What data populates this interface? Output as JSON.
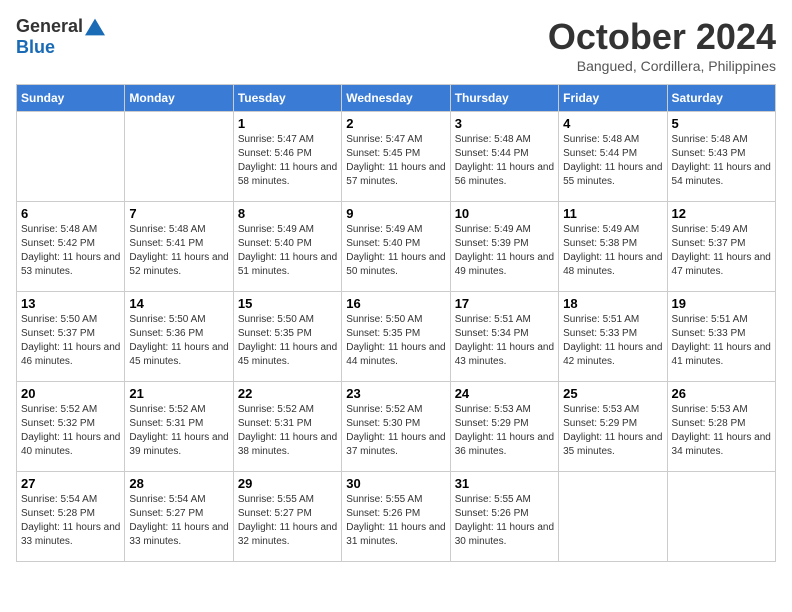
{
  "header": {
    "logo_general": "General",
    "logo_blue": "Blue",
    "month_title": "October 2024",
    "subtitle": "Bangued, Cordillera, Philippines"
  },
  "weekdays": [
    "Sunday",
    "Monday",
    "Tuesday",
    "Wednesday",
    "Thursday",
    "Friday",
    "Saturday"
  ],
  "weeks": [
    [
      {
        "day": "",
        "sunrise": "",
        "sunset": "",
        "daylight": ""
      },
      {
        "day": "",
        "sunrise": "",
        "sunset": "",
        "daylight": ""
      },
      {
        "day": "1",
        "sunrise": "Sunrise: 5:47 AM",
        "sunset": "Sunset: 5:46 PM",
        "daylight": "Daylight: 11 hours and 58 minutes."
      },
      {
        "day": "2",
        "sunrise": "Sunrise: 5:47 AM",
        "sunset": "Sunset: 5:45 PM",
        "daylight": "Daylight: 11 hours and 57 minutes."
      },
      {
        "day": "3",
        "sunrise": "Sunrise: 5:48 AM",
        "sunset": "Sunset: 5:44 PM",
        "daylight": "Daylight: 11 hours and 56 minutes."
      },
      {
        "day": "4",
        "sunrise": "Sunrise: 5:48 AM",
        "sunset": "Sunset: 5:44 PM",
        "daylight": "Daylight: 11 hours and 55 minutes."
      },
      {
        "day": "5",
        "sunrise": "Sunrise: 5:48 AM",
        "sunset": "Sunset: 5:43 PM",
        "daylight": "Daylight: 11 hours and 54 minutes."
      }
    ],
    [
      {
        "day": "6",
        "sunrise": "Sunrise: 5:48 AM",
        "sunset": "Sunset: 5:42 PM",
        "daylight": "Daylight: 11 hours and 53 minutes."
      },
      {
        "day": "7",
        "sunrise": "Sunrise: 5:48 AM",
        "sunset": "Sunset: 5:41 PM",
        "daylight": "Daylight: 11 hours and 52 minutes."
      },
      {
        "day": "8",
        "sunrise": "Sunrise: 5:49 AM",
        "sunset": "Sunset: 5:40 PM",
        "daylight": "Daylight: 11 hours and 51 minutes."
      },
      {
        "day": "9",
        "sunrise": "Sunrise: 5:49 AM",
        "sunset": "Sunset: 5:40 PM",
        "daylight": "Daylight: 11 hours and 50 minutes."
      },
      {
        "day": "10",
        "sunrise": "Sunrise: 5:49 AM",
        "sunset": "Sunset: 5:39 PM",
        "daylight": "Daylight: 11 hours and 49 minutes."
      },
      {
        "day": "11",
        "sunrise": "Sunrise: 5:49 AM",
        "sunset": "Sunset: 5:38 PM",
        "daylight": "Daylight: 11 hours and 48 minutes."
      },
      {
        "day": "12",
        "sunrise": "Sunrise: 5:49 AM",
        "sunset": "Sunset: 5:37 PM",
        "daylight": "Daylight: 11 hours and 47 minutes."
      }
    ],
    [
      {
        "day": "13",
        "sunrise": "Sunrise: 5:50 AM",
        "sunset": "Sunset: 5:37 PM",
        "daylight": "Daylight: 11 hours and 46 minutes."
      },
      {
        "day": "14",
        "sunrise": "Sunrise: 5:50 AM",
        "sunset": "Sunset: 5:36 PM",
        "daylight": "Daylight: 11 hours and 45 minutes."
      },
      {
        "day": "15",
        "sunrise": "Sunrise: 5:50 AM",
        "sunset": "Sunset: 5:35 PM",
        "daylight": "Daylight: 11 hours and 45 minutes."
      },
      {
        "day": "16",
        "sunrise": "Sunrise: 5:50 AM",
        "sunset": "Sunset: 5:35 PM",
        "daylight": "Daylight: 11 hours and 44 minutes."
      },
      {
        "day": "17",
        "sunrise": "Sunrise: 5:51 AM",
        "sunset": "Sunset: 5:34 PM",
        "daylight": "Daylight: 11 hours and 43 minutes."
      },
      {
        "day": "18",
        "sunrise": "Sunrise: 5:51 AM",
        "sunset": "Sunset: 5:33 PM",
        "daylight": "Daylight: 11 hours and 42 minutes."
      },
      {
        "day": "19",
        "sunrise": "Sunrise: 5:51 AM",
        "sunset": "Sunset: 5:33 PM",
        "daylight": "Daylight: 11 hours and 41 minutes."
      }
    ],
    [
      {
        "day": "20",
        "sunrise": "Sunrise: 5:52 AM",
        "sunset": "Sunset: 5:32 PM",
        "daylight": "Daylight: 11 hours and 40 minutes."
      },
      {
        "day": "21",
        "sunrise": "Sunrise: 5:52 AM",
        "sunset": "Sunset: 5:31 PM",
        "daylight": "Daylight: 11 hours and 39 minutes."
      },
      {
        "day": "22",
        "sunrise": "Sunrise: 5:52 AM",
        "sunset": "Sunset: 5:31 PM",
        "daylight": "Daylight: 11 hours and 38 minutes."
      },
      {
        "day": "23",
        "sunrise": "Sunrise: 5:52 AM",
        "sunset": "Sunset: 5:30 PM",
        "daylight": "Daylight: 11 hours and 37 minutes."
      },
      {
        "day": "24",
        "sunrise": "Sunrise: 5:53 AM",
        "sunset": "Sunset: 5:29 PM",
        "daylight": "Daylight: 11 hours and 36 minutes."
      },
      {
        "day": "25",
        "sunrise": "Sunrise: 5:53 AM",
        "sunset": "Sunset: 5:29 PM",
        "daylight": "Daylight: 11 hours and 35 minutes."
      },
      {
        "day": "26",
        "sunrise": "Sunrise: 5:53 AM",
        "sunset": "Sunset: 5:28 PM",
        "daylight": "Daylight: 11 hours and 34 minutes."
      }
    ],
    [
      {
        "day": "27",
        "sunrise": "Sunrise: 5:54 AM",
        "sunset": "Sunset: 5:28 PM",
        "daylight": "Daylight: 11 hours and 33 minutes."
      },
      {
        "day": "28",
        "sunrise": "Sunrise: 5:54 AM",
        "sunset": "Sunset: 5:27 PM",
        "daylight": "Daylight: 11 hours and 33 minutes."
      },
      {
        "day": "29",
        "sunrise": "Sunrise: 5:55 AM",
        "sunset": "Sunset: 5:27 PM",
        "daylight": "Daylight: 11 hours and 32 minutes."
      },
      {
        "day": "30",
        "sunrise": "Sunrise: 5:55 AM",
        "sunset": "Sunset: 5:26 PM",
        "daylight": "Daylight: 11 hours and 31 minutes."
      },
      {
        "day": "31",
        "sunrise": "Sunrise: 5:55 AM",
        "sunset": "Sunset: 5:26 PM",
        "daylight": "Daylight: 11 hours and 30 minutes."
      },
      {
        "day": "",
        "sunrise": "",
        "sunset": "",
        "daylight": ""
      },
      {
        "day": "",
        "sunrise": "",
        "sunset": "",
        "daylight": ""
      }
    ]
  ]
}
